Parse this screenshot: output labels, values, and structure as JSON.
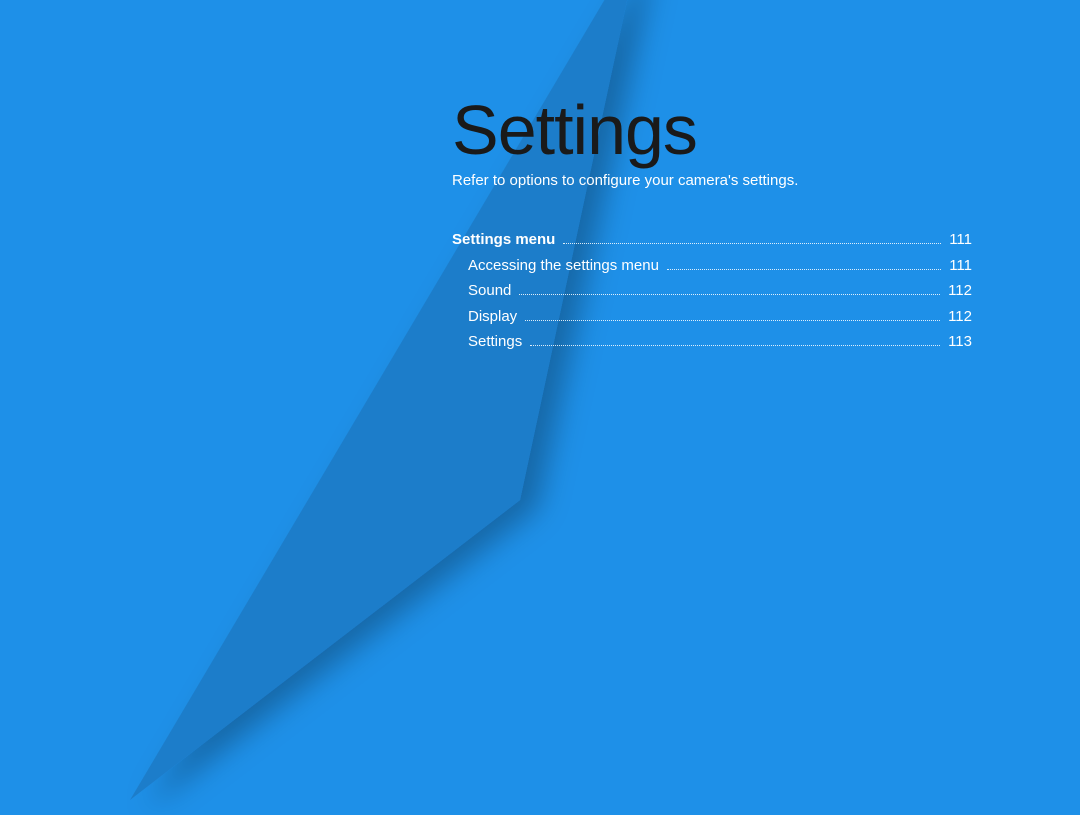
{
  "title": "Settings",
  "subtitle": "Refer to options to configure your camera's settings.",
  "toc": {
    "main": {
      "label": "Settings menu",
      "page": "111"
    },
    "items": [
      {
        "label": "Accessing the settings menu",
        "page": "111"
      },
      {
        "label": "Sound",
        "page": "112"
      },
      {
        "label": "Display",
        "page": "112"
      },
      {
        "label": "Settings",
        "page": "113"
      }
    ]
  },
  "colors": {
    "bg": "#1e90e8",
    "triangle": "#1f7dca",
    "shadow": "rgba(0,0,0,0.25)"
  }
}
